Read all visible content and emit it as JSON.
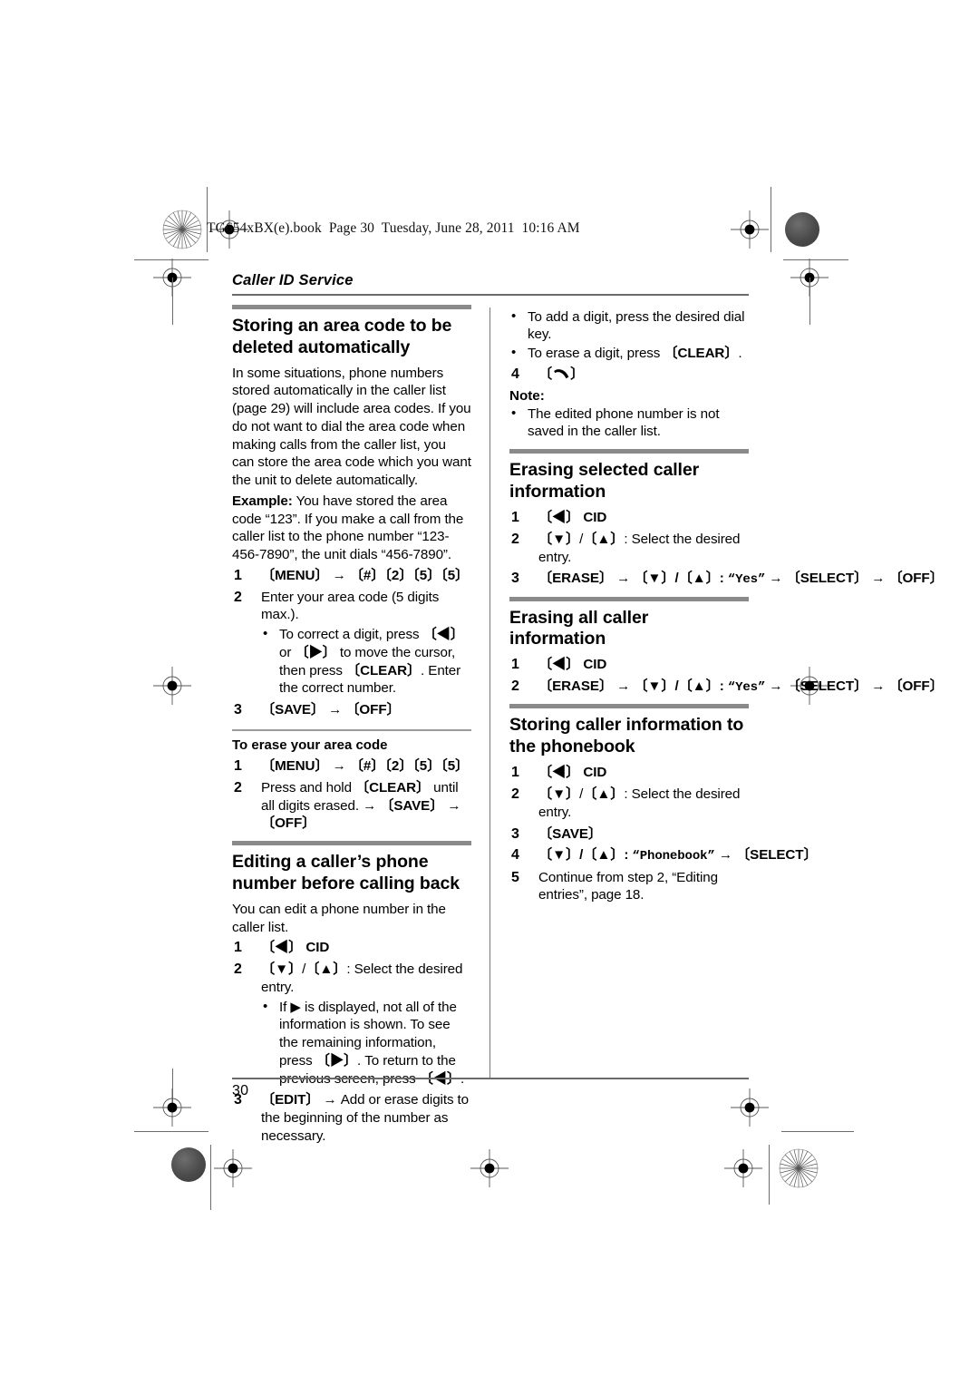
{
  "print_marks": {
    "book_header": "TG654xBX(e).book  Page 30  Tuesday, June 28, 2011  10:16 AM",
    "registration_icon": "registration-crosshair-icon",
    "starburst_icon": "starburst-registration-icon",
    "dot_icon": "solid-dot-registration-icon"
  },
  "running_head": "Caller ID Service",
  "footer": {
    "page_number": "30"
  },
  "left_column": {
    "section1": {
      "heading": "Storing an area code to be deleted automatically",
      "intro": "In some situations, phone numbers stored automatically in the caller list (page 29) will include area codes. If you do not want to dial the area code when making calls from the caller list, you can store the area code which you want the unit to delete automatically.",
      "example_label": "Example:",
      "example_text": " You have stored the area code “123”. If you make a call from the caller list to the phone number “123-456-7890”, the unit dials “456-7890”.",
      "steps": [
        {
          "num": "1",
          "text": "〔MENU〕 → 〔#〕〔2〕〔5〕〔5〕"
        },
        {
          "num": "2",
          "text": "Enter your area code (5 digits max.)."
        },
        {
          "num": "3",
          "text": "〔SAVE〕 → 〔OFF〕"
        }
      ],
      "step2_bullet": "To correct a digit, press 〔◀〕 or 〔▶〕 to move the cursor, then press 〔CLEAR〕. Enter the correct number."
    },
    "subsection1": {
      "heading": "To erase your area code",
      "steps": [
        {
          "num": "1",
          "text": "〔MENU〕 → 〔#〕〔2〕〔5〕〔5〕"
        },
        {
          "num": "2",
          "text": "Press and hold 〔CLEAR〕 until all digits erased. → 〔SAVE〕 → 〔OFF〕"
        }
      ]
    },
    "section2": {
      "heading": "Editing a caller’s phone number before calling back",
      "intro": "You can edit a phone number in the caller list.",
      "steps": [
        {
          "num": "1",
          "text": "〔◀〕 CID"
        },
        {
          "num": "2",
          "text": "〔▼〕/〔▲〕: Select the desired entry."
        },
        {
          "num": "3",
          "text": "〔EDIT〕 → Add or erase digits to the beginning of the number as necessary."
        }
      ],
      "step2_bullet": "If ▶ is displayed, not all of the information is shown. To see the remaining information, press 〔▶〕. To return to the previous screen, press 〔◀〕."
    }
  },
  "right_column": {
    "continued_bullets": [
      "To add a digit, press the desired dial key.",
      "To erase a digit, press 〔CLEAR〕."
    ],
    "step4": {
      "num": "4",
      "label": "talk-handset-icon"
    },
    "note": {
      "label": "Note:",
      "items": [
        "The edited phone number is not saved in the caller list."
      ]
    },
    "section3": {
      "heading": "Erasing selected caller information",
      "steps": [
        {
          "num": "1",
          "text": "〔◀〕 CID"
        },
        {
          "num": "2",
          "text": "〔▼〕/〔▲〕: Select the desired entry."
        },
        {
          "num": "3",
          "text": "〔ERASE〕 → 〔▼〕/〔▲〕: “Yes” → 〔SELECT〕 → 〔OFF〕"
        }
      ]
    },
    "section4": {
      "heading": "Erasing all caller information",
      "steps": [
        {
          "num": "1",
          "text": "〔◀〕 CID"
        },
        {
          "num": "2",
          "text": "〔ERASE〕 → 〔▼〕/〔▲〕: “Yes” → 〔SELECT〕 → 〔OFF〕"
        }
      ]
    },
    "section5": {
      "heading": "Storing caller information to the phonebook",
      "steps": [
        {
          "num": "1",
          "text": "〔◀〕 CID"
        },
        {
          "num": "2",
          "text": "〔▼〕/〔▲〕: Select the desired entry."
        },
        {
          "num": "3",
          "text": "〔SAVE〕"
        },
        {
          "num": "4",
          "text": "〔▼〕/〔▲〕: “Phonebook” → 〔SELECT〕"
        },
        {
          "num": "5",
          "text": "Continue from step 2, “Editing entries”, page 18."
        }
      ]
    }
  }
}
